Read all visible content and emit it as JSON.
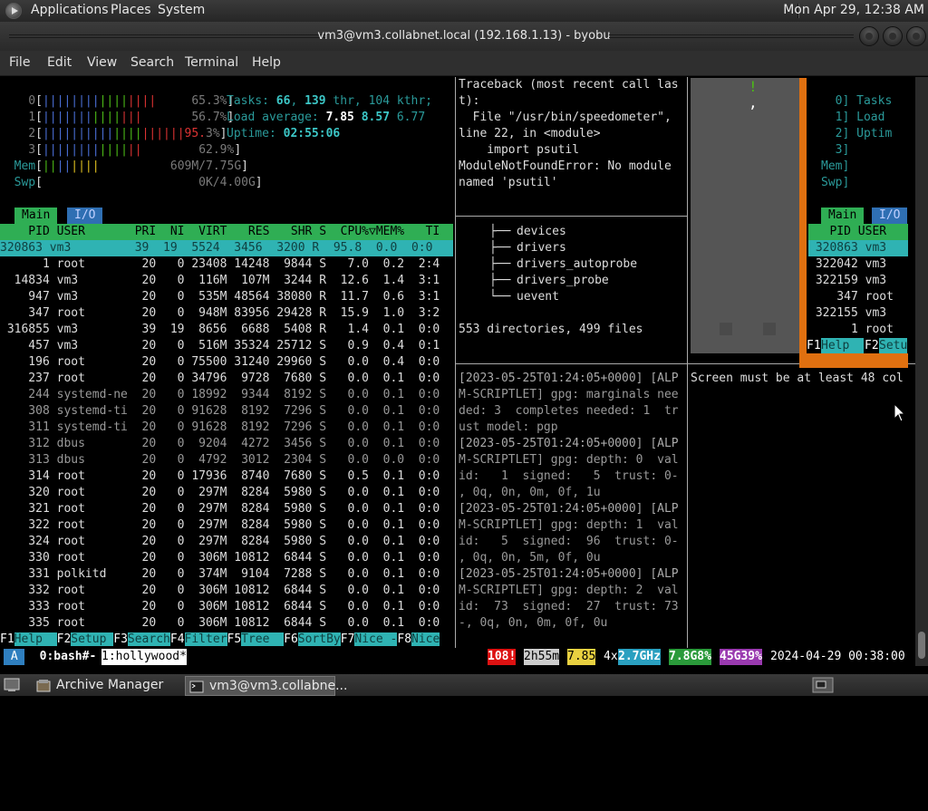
{
  "panel": {
    "menu": [
      "Applications",
      "Places",
      "System"
    ],
    "clock": "Mon Apr 29, 12:38 AM"
  },
  "window": {
    "title": "vm3@vm3.collabnet.local (192.168.1.13) - byobu",
    "menubar": [
      "File",
      "Edit",
      "View",
      "Search",
      "Terminal",
      "Help"
    ]
  },
  "htop": {
    "cpus": [
      {
        "id": "0",
        "bar": "||||||||||||||||",
        "pct": "65.3%"
      },
      {
        "id": "1",
        "bar": "||||||||||||||",
        "pct": "56.7%"
      },
      {
        "id": "2",
        "bar": "||||||||||||||||||95",
        "pct": "3%"
      },
      {
        "id": "3",
        "bar": "||||||||||||||",
        "pct": "62.9%"
      }
    ],
    "mem": "609M/7.75G",
    "swp": "0K/4.00G",
    "tasks_label": "Tasks:",
    "tasks": "66",
    "thr": "139",
    "thr_label": "thr,",
    "kthr": "104 kthr;",
    "load_label": "Load average:",
    "load1": "7.85",
    "load5": "8.57",
    "load15": "6.77",
    "uptime_label": "Uptime:",
    "uptime": "02:55:06",
    "tab_main": "Main",
    "tab_io": "I/O",
    "header": "    PID USER       PRI  NI  VIRT   RES   SHR S  CPU%▽MEM%   TI",
    "rows": [
      "320863 vm3         39  19  5524  3456  3200 R  95.8  0.0  0:0",
      "      1 root        20   0 23408 14248  9844 S   7.0  0.2  2:4",
      "  14834 vm3         20   0  116M  107M  3244 R  12.6  1.4  3:1",
      "    947 vm3         20   0  535M 48564 38080 R  11.7  0.6  3:1",
      "    347 root        20   0  948M 83956 29428 R  15.9  1.0  3:2",
      " 316855 vm3         39  19  8656  6688  5408 R   1.4  0.1  0:0",
      "    457 vm3         20   0  516M 35324 25712 S   0.9  0.4  0:1",
      "    196 root        20   0 75500 31240 29960 S   0.0  0.4  0:0",
      "    237 root        20   0 34796  9728  7680 S   0.0  0.1  0:0",
      "    244 systemd-ne  20   0 18992  9344  8192 S   0.0  0.1  0:0",
      "    308 systemd-ti  20   0 91628  8192  7296 S   0.0  0.1  0:0",
      "    311 systemd-ti  20   0 91628  8192  7296 S   0.0  0.1  0:0",
      "    312 dbus        20   0  9204  4272  3456 S   0.0  0.1  0:0",
      "    313 dbus        20   0  4792  3012  2304 S   0.0  0.0  0:0",
      "    314 root        20   0 17936  8740  7680 S   0.5  0.1  0:0",
      "    320 root        20   0  297M  8284  5980 S   0.0  0.1  0:0",
      "    321 root        20   0  297M  8284  5980 S   0.0  0.1  0:0",
      "    322 root        20   0  297M  8284  5980 S   0.0  0.1  0:0",
      "    324 root        20   0  297M  8284  5980 S   0.0  0.1  0:0",
      "    330 root        20   0  306M 10812  6844 S   0.0  0.1  0:0",
      "    331 polkitd     20   0  374M  9104  7288 S   0.0  0.1  0:0",
      "    332 root        20   0  306M 10812  6844 S   0.0  0.1  0:0",
      "    333 root        20   0  306M 10812  6844 S   0.0  0.1  0:0",
      "    335 root        20   0  306M 10812  6844 S   0.0  0.1  0:0"
    ],
    "fkeys": [
      {
        "k": "F1",
        "l": "Help  "
      },
      {
        "k": "F2",
        "l": "Setup "
      },
      {
        "k": "F3",
        "l": "Search"
      },
      {
        "k": "F4",
        "l": "Filter"
      },
      {
        "k": "F5",
        "l": "Tree  "
      },
      {
        "k": "F6",
        "l": "SortBy"
      },
      {
        "k": "F7",
        "l": "Nice -"
      },
      {
        "k": "F8",
        "l": "Nice"
      }
    ]
  },
  "traceback": [
    "Traceback (most recent call las",
    "t):",
    "  File \"/usr/bin/speedometer\",",
    "line 22, in <module>",
    "    import psutil",
    "ModuleNotFoundError: No module",
    "named 'psutil'"
  ],
  "tree": {
    "items": [
      "devices",
      "drivers",
      "drivers_autoprobe",
      "drivers_probe",
      "uevent"
    ],
    "summary": "553 directories, 499 files"
  },
  "log": [
    "[2023-05-25T01:24:05+0000] [ALP",
    "M-SCRIPTLET] gpg: marginals nee",
    "ded: 3  completes needed: 1  tr",
    "ust model: pgp",
    "[2023-05-25T01:24:05+0000] [ALP",
    "M-SCRIPTLET] gpg: depth: 0  val",
    "id:   1  signed:   5  trust: 0-",
    ", 0q, 0n, 0m, 0f, 1u",
    "[2023-05-25T01:24:05+0000] [ALP",
    "M-SCRIPTLET] gpg: depth: 1  val",
    "id:   5  signed:  96  trust: 0-",
    ", 0q, 0n, 5m, 0f, 0u",
    "[2023-05-25T01:24:05+0000] [ALP",
    "M-SCRIPTLET] gpg: depth: 2  val",
    "id:  73  signed:  27  trust: 73",
    "-, 0q, 0n, 0m, 0f, 0u"
  ],
  "small_pane": {
    "mark1": "!",
    "mark2": ","
  },
  "screen_msg": "Screen must be at least 48 col",
  "mini_htop": {
    "cpu_lines": [
      "  0] Tasks",
      "  1] Load ",
      "  2] Uptim",
      "  3]"
    ],
    "mem": "Mem]",
    "swp": "Swp]",
    "tab_main": "Main",
    "tab_io": "I/O",
    "header": "   PID USER",
    "rows": [
      " 320863 vm3",
      " 322042 vm3",
      " 322159 vm3",
      "    347 root",
      " 322155 vm3",
      "      1 root"
    ],
    "f1": "F1",
    "f1l": "Help  ",
    "f2": "F2",
    "f2l": "Setu"
  },
  "status": {
    "a": " A ",
    "win0": "  0:bash#- ",
    "win1": "1:hollywood*",
    "updates": "108!",
    "uptime": "2h55m",
    "load": "7.85",
    "cpu_count": "4x",
    "freq": "2.7GHz",
    "mem": "7.8G8%",
    "disk": "45G39%",
    "datetime": "2024-04-29 00:38:00"
  },
  "taskbar": {
    "items": [
      "Archive Manager",
      "vm3@vm3.collabne..."
    ]
  }
}
